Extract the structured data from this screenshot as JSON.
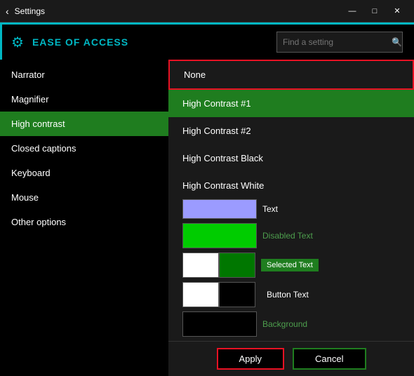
{
  "titlebar": {
    "title": "Settings",
    "back_label": "‹",
    "minimize_label": "—",
    "maximize_label": "□",
    "close_label": "✕"
  },
  "header": {
    "title": "EASE OF ACCESS",
    "search_placeholder": "Find a setting"
  },
  "sidebar": {
    "items": [
      {
        "id": "narrator",
        "label": "Narrator"
      },
      {
        "id": "magnifier",
        "label": "Magnifier"
      },
      {
        "id": "high-contrast",
        "label": "High contrast",
        "active": true
      },
      {
        "id": "closed-captions",
        "label": "Closed captions"
      },
      {
        "id": "keyboard",
        "label": "Keyboard"
      },
      {
        "id": "mouse",
        "label": "Mouse"
      },
      {
        "id": "other-options",
        "label": "Other options"
      }
    ]
  },
  "dropdown": {
    "items": [
      {
        "id": "none",
        "label": "None",
        "bordered": true
      },
      {
        "id": "hc1",
        "label": "High Contrast #1",
        "selected": true
      },
      {
        "id": "hc2",
        "label": "High Contrast #2"
      },
      {
        "id": "hcblack",
        "label": "High Contrast Black"
      },
      {
        "id": "hcwhite",
        "label": "High Contrast White"
      }
    ]
  },
  "color_samples": {
    "rows": [
      {
        "swatches": [
          {
            "color": "#9b9bff"
          }
        ],
        "label": "",
        "label_color": ""
      },
      {
        "swatches": [
          {
            "color": "#00cc00"
          },
          {
            "color": "#00cc00"
          }
        ],
        "label": "Disabled Text",
        "label_type": "disabled"
      },
      {
        "swatches": [
          {
            "color": "#ffffff"
          },
          {
            "color": "#007700"
          }
        ],
        "label": "Selected Text",
        "label_type": "badge"
      },
      {
        "swatches": [
          {
            "color": "#ffffff"
          },
          {
            "color": "#000000"
          }
        ],
        "label": "Button Text",
        "label_type": "normal"
      },
      {
        "swatches": [
          {
            "color": "#000000"
          }
        ],
        "label": "Background",
        "label_type": "disabled"
      }
    ]
  },
  "buttons": {
    "apply": "Apply",
    "cancel": "Cancel"
  }
}
